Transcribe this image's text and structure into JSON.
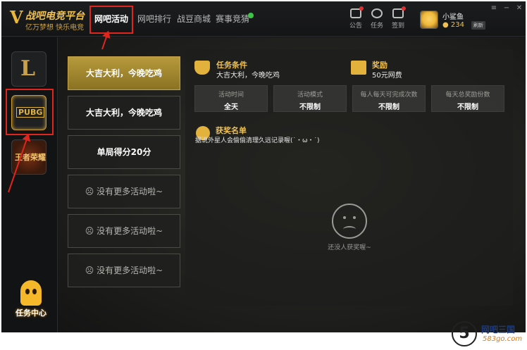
{
  "app": {
    "logo_title": "战吧电竞平台",
    "logo_sub": "亿万梦想 快乐电竞"
  },
  "nav": {
    "tabs": [
      {
        "label": "网吧活动"
      },
      {
        "label": "网吧排行"
      },
      {
        "label": "战豆商城"
      },
      {
        "label": "赛事竞猜"
      }
    ]
  },
  "toolbar": {
    "notice": "公告",
    "task": "任务",
    "signin": "签到"
  },
  "user": {
    "name": "小鲨鱼",
    "coins": "234",
    "refresh": "刷新"
  },
  "sidebar": {
    "games": [
      {
        "label": "L"
      },
      {
        "label": "PUBG"
      },
      {
        "label": "王者荣耀"
      }
    ],
    "task_center": "任务中心"
  },
  "activities": [
    {
      "label": "大吉大利，今晚吃鸡"
    },
    {
      "label": "大吉大利，今晚吃鸡"
    },
    {
      "label": "单局得分20分"
    },
    {
      "label": "☹ 没有更多活动啦~"
    },
    {
      "label": "☹ 没有更多活动啦~"
    },
    {
      "label": "☹ 没有更多活动啦~"
    }
  ],
  "detail": {
    "task_condition_title": "任务条件",
    "task_condition_text": "大吉大利，今晚吃鸡",
    "reward_title": "奖励",
    "reward_text": "50元网费",
    "conditions": [
      {
        "key": "活动时间",
        "value": "全天"
      },
      {
        "key": "活动模式",
        "value": "不限制"
      },
      {
        "key": "每人每天可完成次数",
        "value": "不限制"
      },
      {
        "key": "每天总奖励份数",
        "value": "不限制"
      }
    ],
    "winners_title": "获奖名单",
    "winners_text": "据说外星人会偷偷清理久远记录喔(˙・ω・˙)",
    "no_winner": "还没人获奖喔~"
  },
  "watermark": {
    "digit": "5",
    "name": "网吧三国",
    "url": "583go.com"
  },
  "colors": {
    "accent": "#f0c050",
    "annotation": "#e0251f"
  }
}
